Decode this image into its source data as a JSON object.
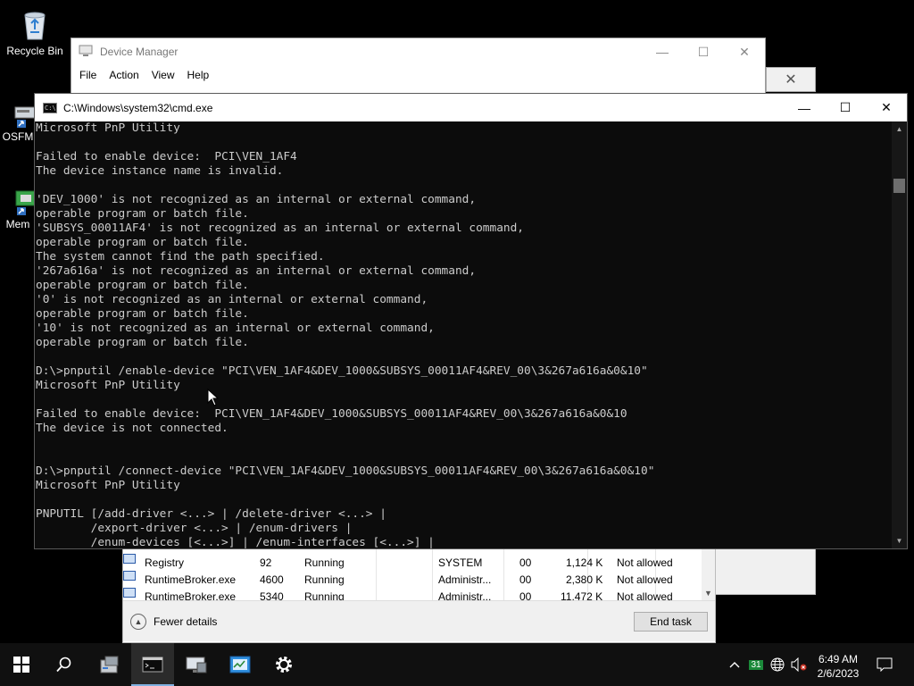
{
  "desktop": {
    "icons": [
      {
        "label": "Recycle Bin"
      },
      {
        "label": "OSFM"
      },
      {
        "label": "Mem"
      }
    ]
  },
  "device_manager": {
    "title": "Device Manager",
    "menu": [
      "File",
      "Action",
      "View",
      "Help"
    ],
    "controls": {
      "minimize": "—",
      "maximize": "☐",
      "close": "✕"
    }
  },
  "task_manager": {
    "close_glyph": "✕",
    "rows": [
      {
        "name": "Registry",
        "pid": "92",
        "status": "Running",
        "user": "SYSTEM",
        "cpu": "00",
        "memory": "1,124 K",
        "uac": "Not allowed"
      },
      {
        "name": "RuntimeBroker.exe",
        "pid": "4600",
        "status": "Running",
        "user": "Administr...",
        "cpu": "00",
        "memory": "2,380 K",
        "uac": "Not allowed"
      },
      {
        "name": "RuntimeBroker.exe",
        "pid": "5340",
        "status": "Running",
        "user": "Administr...",
        "cpu": "00",
        "memory": "11,472 K",
        "uac": "Not allowed"
      }
    ],
    "fewer_details": "Fewer details",
    "end_task": "End task"
  },
  "cmd": {
    "title": "C:\\Windows\\system32\\cmd.exe",
    "icon_text": "C:\\",
    "controls": {
      "minimize": "—",
      "maximize": "☐",
      "close": "✕"
    },
    "lines": [
      "Microsoft PnP Utility",
      "",
      "Failed to enable device:  PCI\\VEN_1AF4",
      "The device instance name is invalid.",
      "",
      "'DEV_1000' is not recognized as an internal or external command,",
      "operable program or batch file.",
      "'SUBSYS_00011AF4' is not recognized as an internal or external command,",
      "operable program or batch file.",
      "The system cannot find the path specified.",
      "'267a616a' is not recognized as an internal or external command,",
      "operable program or batch file.",
      "'0' is not recognized as an internal or external command,",
      "operable program or batch file.",
      "'10' is not recognized as an internal or external command,",
      "operable program or batch file.",
      "",
      "D:\\>pnputil /enable-device \"PCI\\VEN_1AF4&DEV_1000&SUBSYS_00011AF4&REV_00\\3&267a616a&0&10\"",
      "Microsoft PnP Utility",
      "",
      "Failed to enable device:  PCI\\VEN_1AF4&DEV_1000&SUBSYS_00011AF4&REV_00\\3&267a616a&0&10",
      "The device is not connected.",
      "",
      "",
      "D:\\>pnputil /connect-device \"PCI\\VEN_1AF4&DEV_1000&SUBSYS_00011AF4&REV_00\\3&267a616a&0&10\"",
      "Microsoft PnP Utility",
      "",
      "PNPUTIL [/add-driver <...> | /delete-driver <...> |",
      "        /export-driver <...> | /enum-drivers |",
      "        /enum-devices [<...>] | /enum-interfaces [<...>] |"
    ]
  },
  "taskbar": {
    "tray_date_icon": "31",
    "time": "6:49 AM",
    "date": "2/6/2023"
  }
}
